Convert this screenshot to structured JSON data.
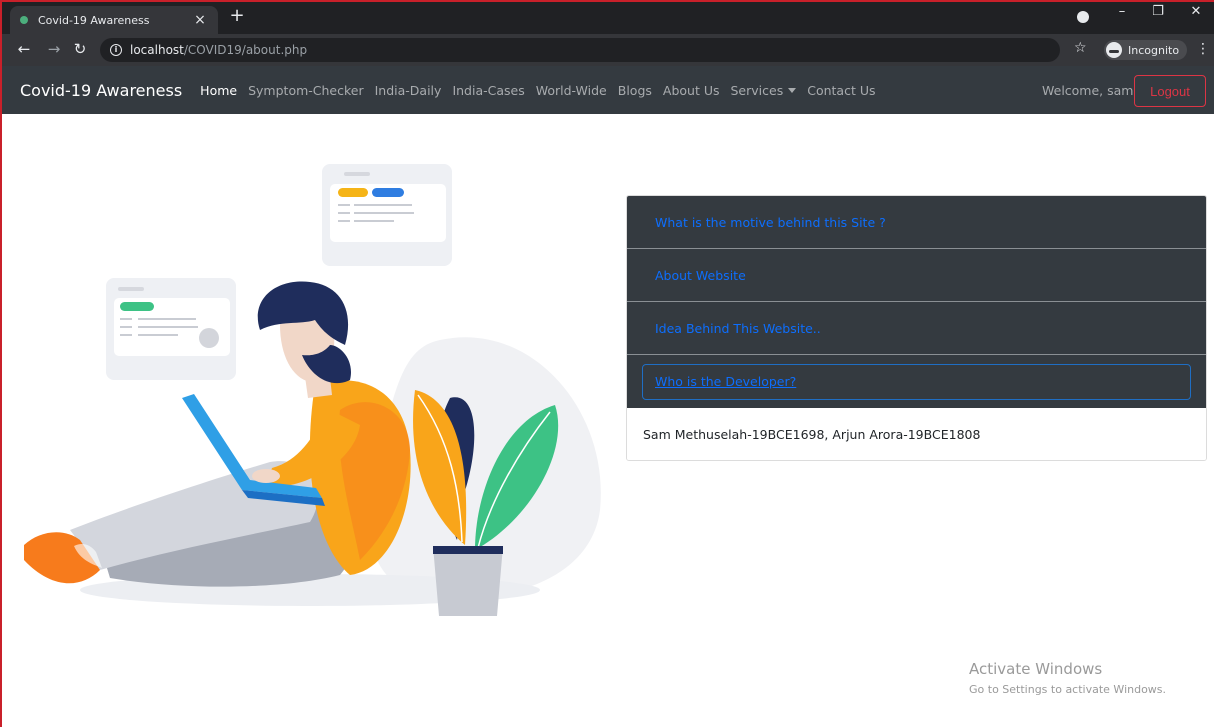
{
  "browser": {
    "tab_title": "Covid-19 Awareness",
    "tab_close": "×",
    "new_tab": "+",
    "url_host": "localhost",
    "url_path": "/COVID19/about.php",
    "incognito_label": "Incognito",
    "controls": {
      "minimize": "–",
      "restore": "❐",
      "close": "✕"
    }
  },
  "navbar": {
    "brand": "Covid-19 Awareness",
    "links": [
      "Home",
      "Symptom-Checker",
      "India-Daily",
      "India-Cases",
      "World-Wide",
      "Blogs",
      "About Us",
      "Services",
      "Contact Us"
    ],
    "welcome": "Welcome, sam",
    "logout": "Logout"
  },
  "accordion": {
    "items": [
      "What is the motive behind this Site ?",
      "About Website",
      "Idea Behind This Website..",
      "Who is the Developer?"
    ],
    "open_body": "Sam Methuselah-19BCE1698, Arjun Arora-19BCE1808"
  },
  "watermark": {
    "title": "Activate Windows",
    "subtitle": "Go to Settings to activate Windows."
  },
  "colors": {
    "navbar_bg": "#343a40",
    "link_blue": "#0d6efd",
    "logout_red": "#dc3545",
    "shirt_orange": "#f9a51a",
    "hair_navy": "#1f2d5c",
    "leaf_green": "#3dc285"
  }
}
